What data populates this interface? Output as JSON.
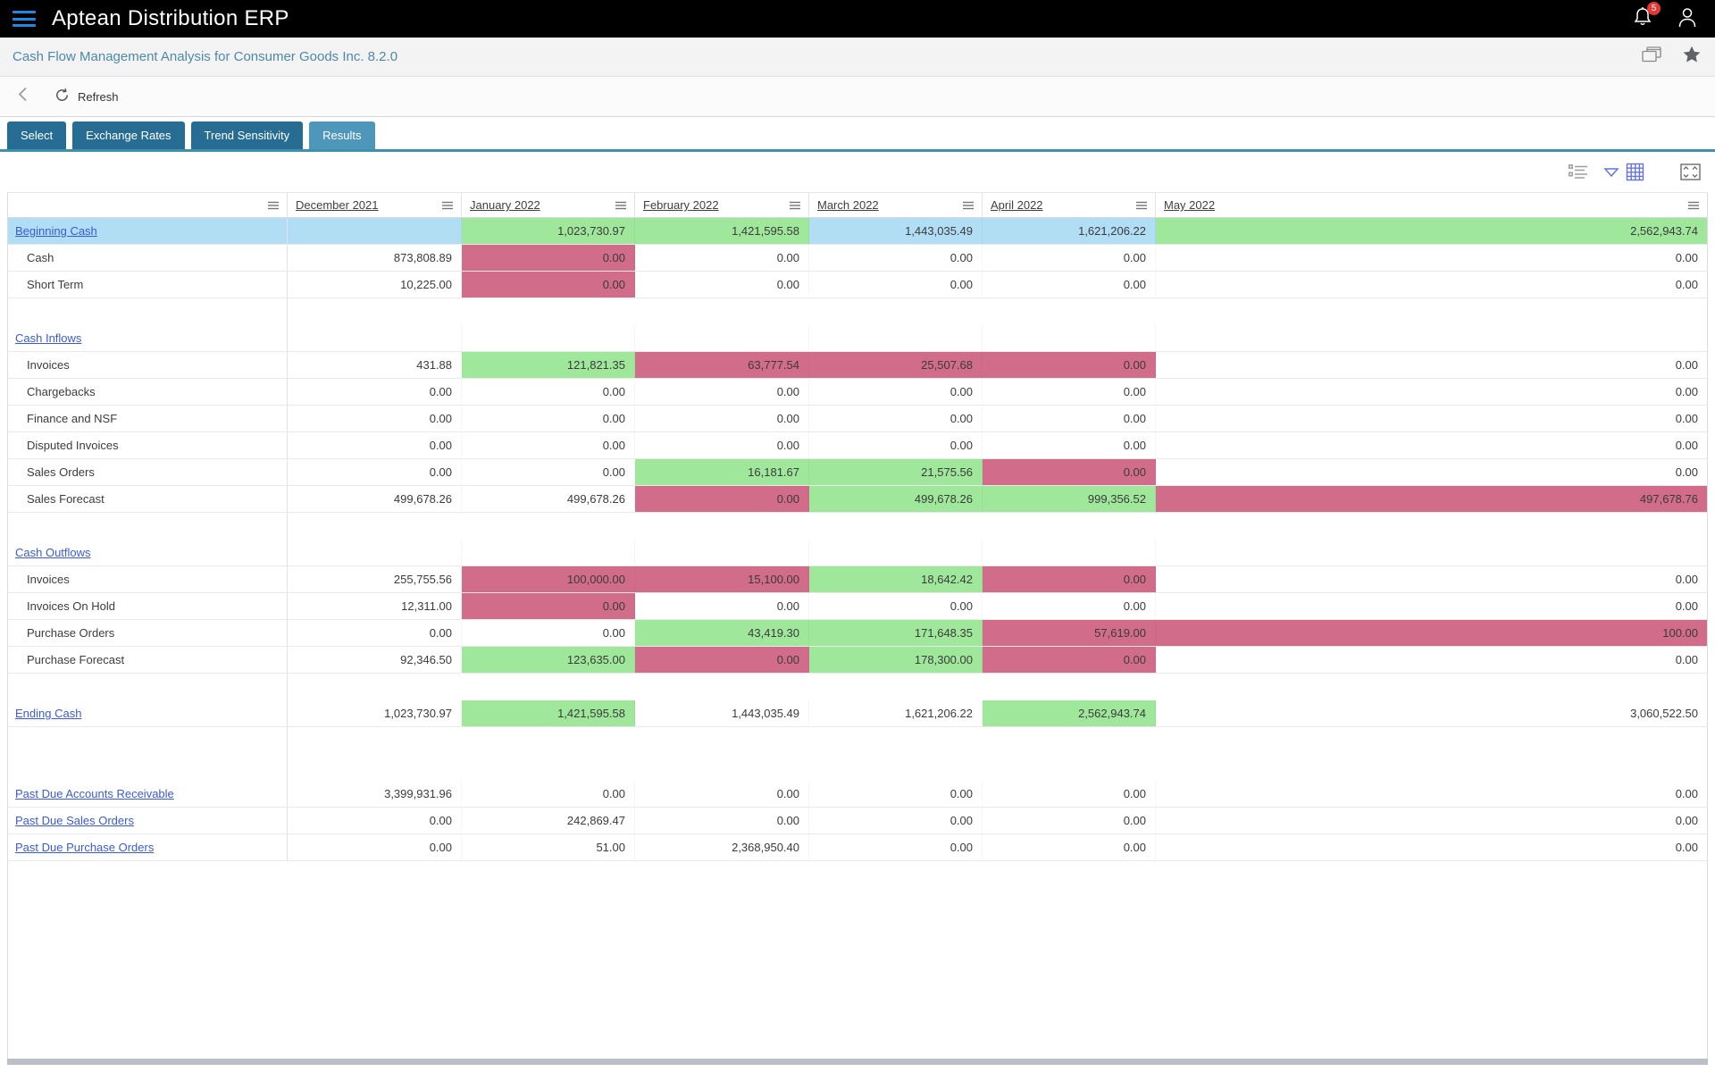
{
  "app": {
    "title": "Aptean Distribution ERP",
    "notification_count": "5"
  },
  "breadcrumb": {
    "title": "Cash Flow Management Analysis for Consumer Goods Inc. 8.2.0"
  },
  "toolbar": {
    "refresh_label": "Refresh"
  },
  "tabs": [
    {
      "label": "Select",
      "active": false
    },
    {
      "label": "Exchange Rates",
      "active": false
    },
    {
      "label": "Trend Sensitivity",
      "active": false
    },
    {
      "label": "Results",
      "active": true
    }
  ],
  "view_toolbar": {
    "icons": [
      "row-grouping-icon",
      "chevron-down-icon",
      "grid-view-icon",
      "fullscreen-icon"
    ]
  },
  "colors": {
    "positive": "#9fe79b",
    "negative": "#d16d8a",
    "highlight": "#b1ddf5",
    "tab_inactive": "#276d93",
    "tab_active": "#4e96ba",
    "accent_line": "#3e91ae",
    "row_link": "#3a5bd9",
    "breadcrumb_text": "#4e89a8",
    "badge": "#e53935"
  },
  "table": {
    "columns": [
      "December 2021",
      "January 2022",
      "February 2022",
      "March 2022",
      "April 2022",
      "May 2022"
    ],
    "rows": [
      {
        "label": "Beginning Cash",
        "style": "link",
        "highlight": true,
        "cells": [
          [
            "",
            "b"
          ],
          [
            "1,023,730.97",
            "g"
          ],
          [
            "1,421,595.58",
            "g"
          ],
          [
            "1,443,035.49",
            "b"
          ],
          [
            "1,621,206.22",
            "b"
          ],
          [
            "2,562,943.74",
            "g"
          ]
        ]
      },
      {
        "label": "Cash",
        "style": "item",
        "cells": [
          [
            "873,808.89",
            ""
          ],
          [
            "0.00",
            "p"
          ],
          [
            "0.00",
            ""
          ],
          [
            "0.00",
            ""
          ],
          [
            "0.00",
            ""
          ],
          [
            "0.00",
            ""
          ]
        ]
      },
      {
        "label": "Short Term",
        "style": "item",
        "cells": [
          [
            "10,225.00",
            ""
          ],
          [
            "0.00",
            "p"
          ],
          [
            "0.00",
            ""
          ],
          [
            "0.00",
            ""
          ],
          [
            "0.00",
            ""
          ],
          [
            "0.00",
            ""
          ]
        ]
      },
      {
        "style": "empty",
        "cells": []
      },
      {
        "label": "Cash Inflows",
        "style": "link",
        "cells": [
          [
            "",
            ""
          ],
          [
            "",
            ""
          ],
          [
            "",
            ""
          ],
          [
            "",
            ""
          ],
          [
            "",
            ""
          ],
          [
            "",
            ""
          ]
        ]
      },
      {
        "label": "Invoices",
        "style": "item",
        "cells": [
          [
            "431.88",
            ""
          ],
          [
            "121,821.35",
            "g"
          ],
          [
            "63,777.54",
            "p"
          ],
          [
            "25,507.68",
            "p"
          ],
          [
            "0.00",
            "p"
          ],
          [
            "0.00",
            ""
          ]
        ]
      },
      {
        "label": "Chargebacks",
        "style": "item",
        "cells": [
          [
            "0.00",
            ""
          ],
          [
            "0.00",
            ""
          ],
          [
            "0.00",
            ""
          ],
          [
            "0.00",
            ""
          ],
          [
            "0.00",
            ""
          ],
          [
            "0.00",
            ""
          ]
        ]
      },
      {
        "label": "Finance and NSF",
        "style": "item",
        "cells": [
          [
            "0.00",
            ""
          ],
          [
            "0.00",
            ""
          ],
          [
            "0.00",
            ""
          ],
          [
            "0.00",
            ""
          ],
          [
            "0.00",
            ""
          ],
          [
            "0.00",
            ""
          ]
        ]
      },
      {
        "label": "Disputed Invoices",
        "style": "item",
        "cells": [
          [
            "0.00",
            ""
          ],
          [
            "0.00",
            ""
          ],
          [
            "0.00",
            ""
          ],
          [
            "0.00",
            ""
          ],
          [
            "0.00",
            ""
          ],
          [
            "0.00",
            ""
          ]
        ]
      },
      {
        "label": "Sales Orders",
        "style": "item",
        "cells": [
          [
            "0.00",
            ""
          ],
          [
            "0.00",
            ""
          ],
          [
            "16,181.67",
            "g"
          ],
          [
            "21,575.56",
            "g"
          ],
          [
            "0.00",
            "p"
          ],
          [
            "0.00",
            ""
          ]
        ]
      },
      {
        "label": "Sales Forecast",
        "style": "item",
        "cells": [
          [
            "499,678.26",
            ""
          ],
          [
            "499,678.26",
            ""
          ],
          [
            "0.00",
            "p"
          ],
          [
            "499,678.26",
            "g"
          ],
          [
            "999,356.52",
            "g"
          ],
          [
            "497,678.76",
            "p"
          ]
        ]
      },
      {
        "style": "empty",
        "cells": []
      },
      {
        "label": "Cash Outflows",
        "style": "link",
        "cells": [
          [
            "",
            ""
          ],
          [
            "",
            ""
          ],
          [
            "",
            ""
          ],
          [
            "",
            ""
          ],
          [
            "",
            ""
          ],
          [
            "",
            ""
          ]
        ]
      },
      {
        "label": "Invoices",
        "style": "item",
        "cells": [
          [
            "255,755.56",
            ""
          ],
          [
            "100,000.00",
            "p"
          ],
          [
            "15,100.00",
            "p"
          ],
          [
            "18,642.42",
            "g"
          ],
          [
            "0.00",
            "p"
          ],
          [
            "0.00",
            ""
          ]
        ]
      },
      {
        "label": "Invoices On Hold",
        "style": "item",
        "cells": [
          [
            "12,311.00",
            ""
          ],
          [
            "0.00",
            "p"
          ],
          [
            "0.00",
            ""
          ],
          [
            "0.00",
            ""
          ],
          [
            "0.00",
            ""
          ],
          [
            "0.00",
            ""
          ]
        ]
      },
      {
        "label": "Purchase Orders",
        "style": "item",
        "cells": [
          [
            "0.00",
            ""
          ],
          [
            "0.00",
            ""
          ],
          [
            "43,419.30",
            "g"
          ],
          [
            "171,648.35",
            "g"
          ],
          [
            "57,619.00",
            "p"
          ],
          [
            "100.00",
            "p"
          ]
        ]
      },
      {
        "label": "Purchase Forecast",
        "style": "item",
        "cells": [
          [
            "92,346.50",
            ""
          ],
          [
            "123,635.00",
            "g"
          ],
          [
            "0.00",
            "p"
          ],
          [
            "178,300.00",
            "g"
          ],
          [
            "0.00",
            "p"
          ],
          [
            "0.00",
            ""
          ]
        ]
      },
      {
        "style": "empty",
        "cells": []
      },
      {
        "label": "Ending Cash",
        "style": "link",
        "cells": [
          [
            "1,023,730.97",
            ""
          ],
          [
            "1,421,595.58",
            "g"
          ],
          [
            "1,443,035.49",
            ""
          ],
          [
            "1,621,206.22",
            ""
          ],
          [
            "2,562,943.74",
            "g"
          ],
          [
            "3,060,522.50",
            ""
          ]
        ]
      },
      {
        "style": "empty",
        "cells": []
      },
      {
        "style": "empty",
        "cells": []
      },
      {
        "label": "Past Due Accounts Receivable",
        "style": "link",
        "cells": [
          [
            "3,399,931.96",
            ""
          ],
          [
            "0.00",
            ""
          ],
          [
            "0.00",
            ""
          ],
          [
            "0.00",
            ""
          ],
          [
            "0.00",
            ""
          ],
          [
            "0.00",
            ""
          ]
        ]
      },
      {
        "label": "Past Due Sales Orders",
        "style": "link",
        "cells": [
          [
            "0.00",
            ""
          ],
          [
            "242,869.47",
            ""
          ],
          [
            "0.00",
            ""
          ],
          [
            "0.00",
            ""
          ],
          [
            "0.00",
            ""
          ],
          [
            "0.00",
            ""
          ]
        ]
      },
      {
        "label": "Past Due Purchase Orders",
        "style": "link",
        "cells": [
          [
            "0.00",
            ""
          ],
          [
            "51.00",
            ""
          ],
          [
            "2,368,950.40",
            ""
          ],
          [
            "0.00",
            ""
          ],
          [
            "0.00",
            ""
          ],
          [
            "0.00",
            ""
          ]
        ]
      }
    ]
  }
}
